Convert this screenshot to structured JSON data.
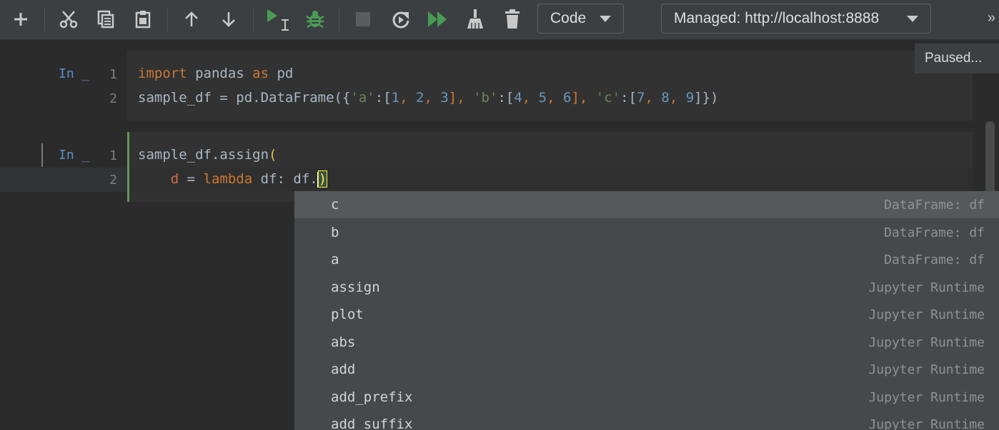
{
  "toolbar": {
    "icons": [
      "add-icon",
      "cut-icon",
      "copy-icon",
      "paste-icon",
      "move-up-icon",
      "move-down-icon",
      "run-cell-icon",
      "debug-icon",
      "stop-icon",
      "restart-icon",
      "run-all-icon",
      "clear-output-icon",
      "delete-icon",
      "more-icon"
    ],
    "cell_type": "Code",
    "server": "Managed: http://localhost:8888",
    "more_glyph": "»"
  },
  "status": "Paused...",
  "cells": [
    {
      "prompt": "In _",
      "lines": [
        {
          "num": "1"
        },
        {
          "num": "2"
        }
      ]
    },
    {
      "prompt": "In _",
      "lines": [
        {
          "num": "1"
        },
        {
          "num": "2"
        }
      ]
    }
  ],
  "code_tokens": {
    "c1l1": [
      "import",
      " pandas ",
      "as",
      " pd"
    ],
    "c1l2": [
      "sample_df = pd.DataFrame({",
      "'a'",
      ":[",
      "1",
      ", ",
      "2",
      ", ",
      "3",
      "], ",
      "'b'",
      ":[",
      "4",
      ", ",
      "5",
      ", ",
      "6",
      "], ",
      "'c'",
      ":[",
      "7",
      ", ",
      "8",
      ", ",
      "9",
      "]})"
    ],
    "c2l1": [
      "sample_df.assign",
      "("
    ],
    "c2l2": [
      "    ",
      "d",
      " = ",
      "lambda",
      " df: df.",
      ")"
    ]
  },
  "completion": {
    "items": [
      {
        "name": "c",
        "source": "DataFrame: df",
        "selected": true
      },
      {
        "name": "b",
        "source": "DataFrame: df"
      },
      {
        "name": "a",
        "source": "DataFrame: df"
      },
      {
        "name": "assign",
        "source": "Jupyter Runtime"
      },
      {
        "name": "plot",
        "source": "Jupyter Runtime"
      },
      {
        "name": "abs",
        "source": "Jupyter Runtime"
      },
      {
        "name": "add",
        "source": "Jupyter Runtime"
      },
      {
        "name": "add_prefix",
        "source": "Jupyter Runtime"
      },
      {
        "name": "add_suffix",
        "source": "Jupyter Runtime"
      }
    ]
  },
  "colors": {
    "run": "#499c54",
    "debug": "#499c54",
    "active_cell": "#629755",
    "prompt": "#5c8fc6"
  }
}
